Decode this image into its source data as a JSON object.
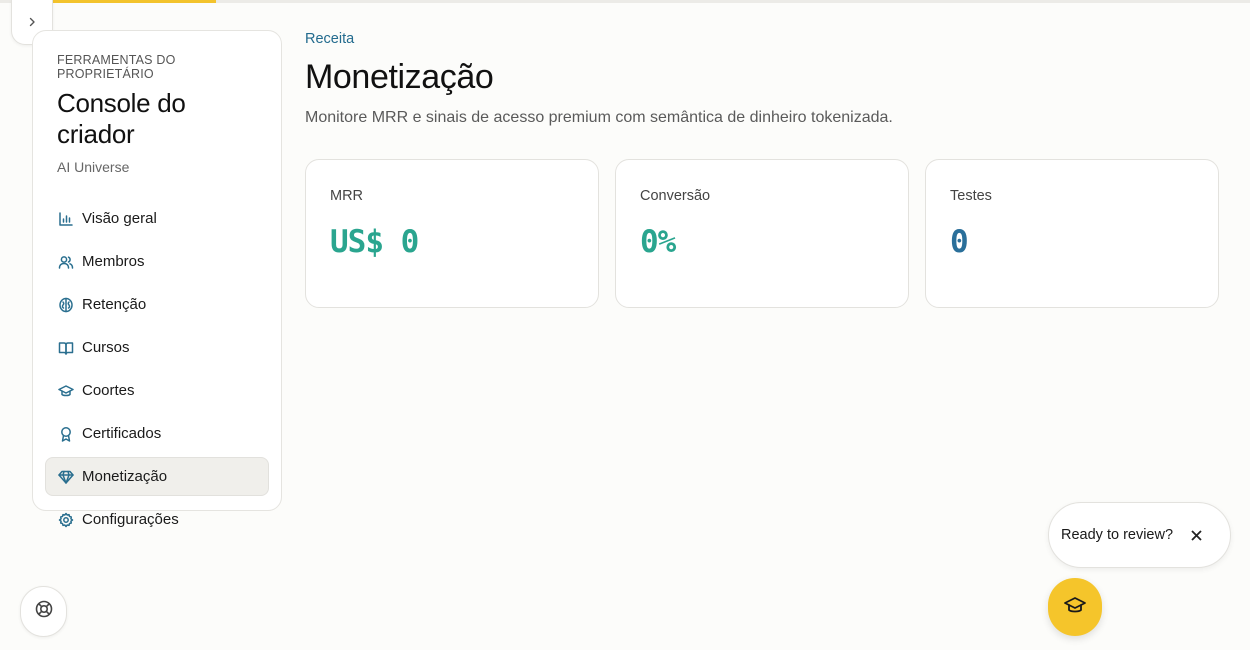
{
  "sidebar": {
    "eyebrow": "FERRAMENTAS DO PROPRIETÁRIO",
    "title": "Console do criador",
    "subtitle": "AI Universe",
    "items": [
      {
        "label": "Visão geral",
        "icon": "bar-chart-icon"
      },
      {
        "label": "Membros",
        "icon": "users-icon"
      },
      {
        "label": "Retenção",
        "icon": "brain-icon"
      },
      {
        "label": "Cursos",
        "icon": "book-open-icon"
      },
      {
        "label": "Coortes",
        "icon": "graduation-cap-icon"
      },
      {
        "label": "Certificados",
        "icon": "award-icon"
      },
      {
        "label": "Monetização",
        "icon": "gem-icon",
        "active": true
      },
      {
        "label": "Configurações",
        "icon": "settings-icon"
      }
    ]
  },
  "main": {
    "breadcrumb": "Receita",
    "title": "Monetização",
    "description": "Monitore MRR e sinais de acesso premium com semântica de dinheiro tokenizada.",
    "cards": [
      {
        "label": "MRR",
        "value": "US$ 0"
      },
      {
        "label": "Conversão",
        "value": "0%"
      },
      {
        "label": "Testes",
        "value": "0"
      }
    ]
  },
  "review_prompt": {
    "text": "Ready to review?"
  },
  "colors": {
    "accent": "#f5c52b",
    "link": "#236b8e",
    "value_teal": "#2aa58f",
    "value_blue": "#2a6f9a"
  }
}
